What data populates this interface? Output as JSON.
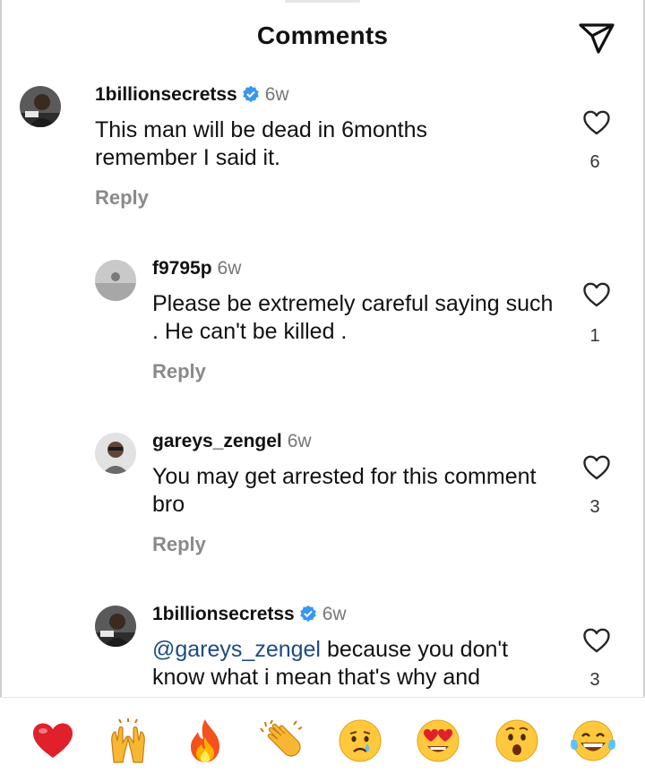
{
  "header": {
    "title": "Comments"
  },
  "comments": [
    {
      "username": "1billionsecretss",
      "verified": true,
      "time": "6w",
      "text": "This man will be dead in 6months remember I said it.",
      "reply_label": "Reply",
      "likes": "6"
    },
    {
      "username": "f9795p",
      "verified": false,
      "time": "6w",
      "text": "Please be extremely careful saying such .  He can't be killed .",
      "reply_label": "Reply",
      "likes": "1"
    },
    {
      "username": "gareys_zengel",
      "verified": false,
      "time": "6w",
      "text": "You may get arrested for this comment bro",
      "reply_label": "Reply",
      "likes": "3"
    },
    {
      "username": "1billionsecretss",
      "verified": true,
      "time": "6w",
      "mention": "@gareys_zengel",
      "text": " because you don't know what i mean  that's why and",
      "likes": "3"
    }
  ],
  "reactions": [
    "heart",
    "raising-hands",
    "fire",
    "clapping-hands",
    "crying-face",
    "heart-eyes-face",
    "astonished-face",
    "tears-of-joy-face"
  ],
  "colors": {
    "verified": "#3897f0",
    "mention": "#1e4a82",
    "secondary_text": "#8a8a8a"
  }
}
